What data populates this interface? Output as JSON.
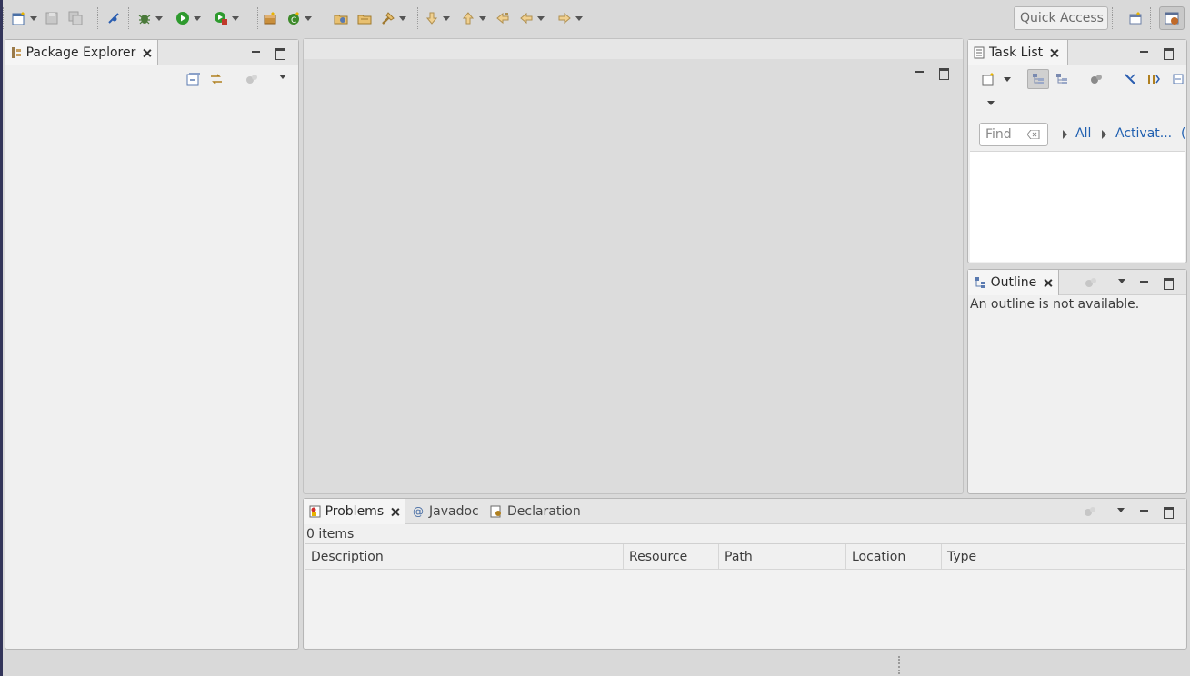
{
  "toolbar": {
    "icons": [
      "new-icon",
      "save-icon",
      "save-all-icon",
      "toggle-breakpoint-icon",
      "debug-icon",
      "run-icon",
      "run-external-icon",
      "new-package-icon",
      "new-class-icon",
      "open-type-icon",
      "open-task-icon",
      "search-icon",
      "next-annotation-icon",
      "previous-annotation-icon",
      "last-edit-icon",
      "back-icon",
      "forward-icon"
    ],
    "quick_access_label": "Quick Access"
  },
  "package_explorer": {
    "tab_label": "Package Explorer"
  },
  "task_list": {
    "tab_label": "Task List",
    "find_placeholder": "Find",
    "all_label": "All",
    "activate_label": "Activat..."
  },
  "outline": {
    "tab_label": "Outline",
    "message": "An outline is not available."
  },
  "bottom": {
    "tabs": [
      "Problems",
      "Javadoc",
      "Declaration"
    ],
    "items_count": "0 items",
    "columns": [
      "Description",
      "Resource",
      "Path",
      "Location",
      "Type"
    ]
  },
  "colors": {
    "background": "#d9d9d9",
    "panel": "#f0f0f0",
    "link": "#1f5fb0",
    "run_green": "#2e9a2e"
  }
}
